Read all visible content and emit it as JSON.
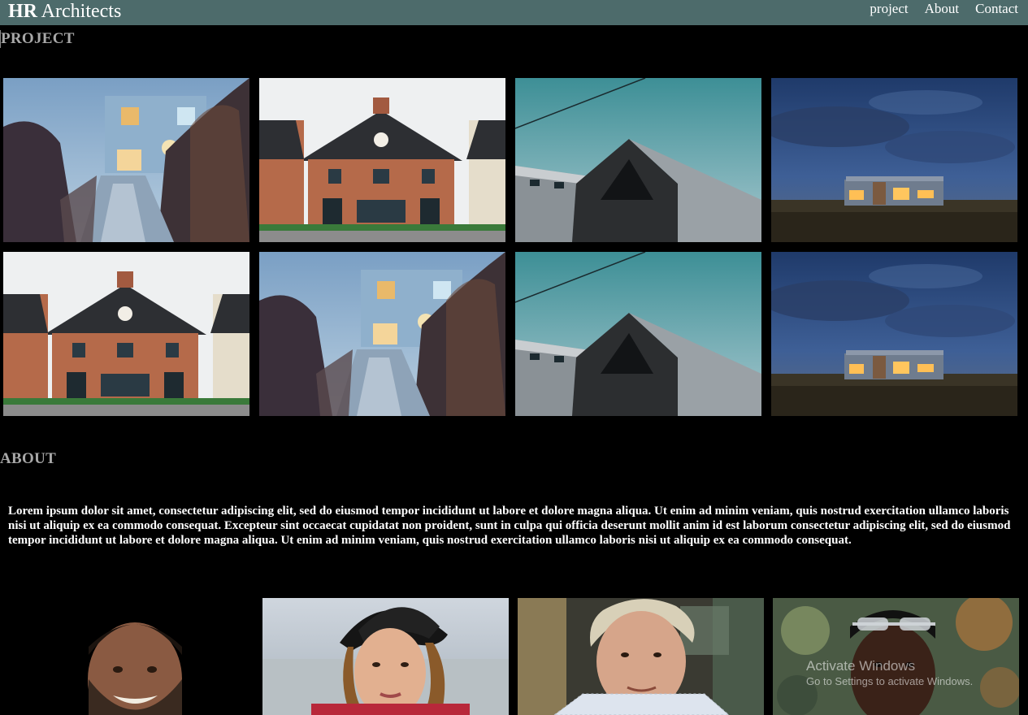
{
  "navbar": {
    "brand_bold": "HR",
    "brand_rest": " Architects",
    "links": [
      {
        "label": "project"
      },
      {
        "label": "About"
      },
      {
        "label": "Contact"
      }
    ]
  },
  "project": {
    "title": "PROJECT",
    "images": [
      {
        "kind": "boardwalk-house"
      },
      {
        "kind": "brick-house"
      },
      {
        "kind": "dark-gable-house"
      },
      {
        "kind": "night-house"
      },
      {
        "kind": "brick-house"
      },
      {
        "kind": "boardwalk-house"
      },
      {
        "kind": "dark-gable-house"
      },
      {
        "kind": "night-house"
      }
    ]
  },
  "about": {
    "title": "ABOUT",
    "text": "Lorem ipsum dolor sit amet, consectetur adipiscing elit, sed do eiusmod tempor incididunt ut labore et dolore magna aliqua. Ut enim ad minim veniam, quis nostrud exercitation ullamco laboris nisi ut aliquip ex ea commodo consequat. Excepteur sint occaecat cupidatat non proident, sunt in culpa qui officia deserunt mollit anim id est laborum consectetur adipiscing elit, sed do eiusmod tempor incididunt ut labore et dolore magna aliqua. Ut enim ad minim veniam, quis nostrud exercitation ullamco laboris nisi ut aliquip ex ea commodo consequat."
  },
  "team": [
    {
      "kind": "bearded-man"
    },
    {
      "kind": "woman-hat"
    },
    {
      "kind": "older-man"
    },
    {
      "kind": "man-sunglasses"
    }
  ],
  "watermark": {
    "line1": "Activate Windows",
    "line2": "Go to Settings to activate Windows."
  }
}
